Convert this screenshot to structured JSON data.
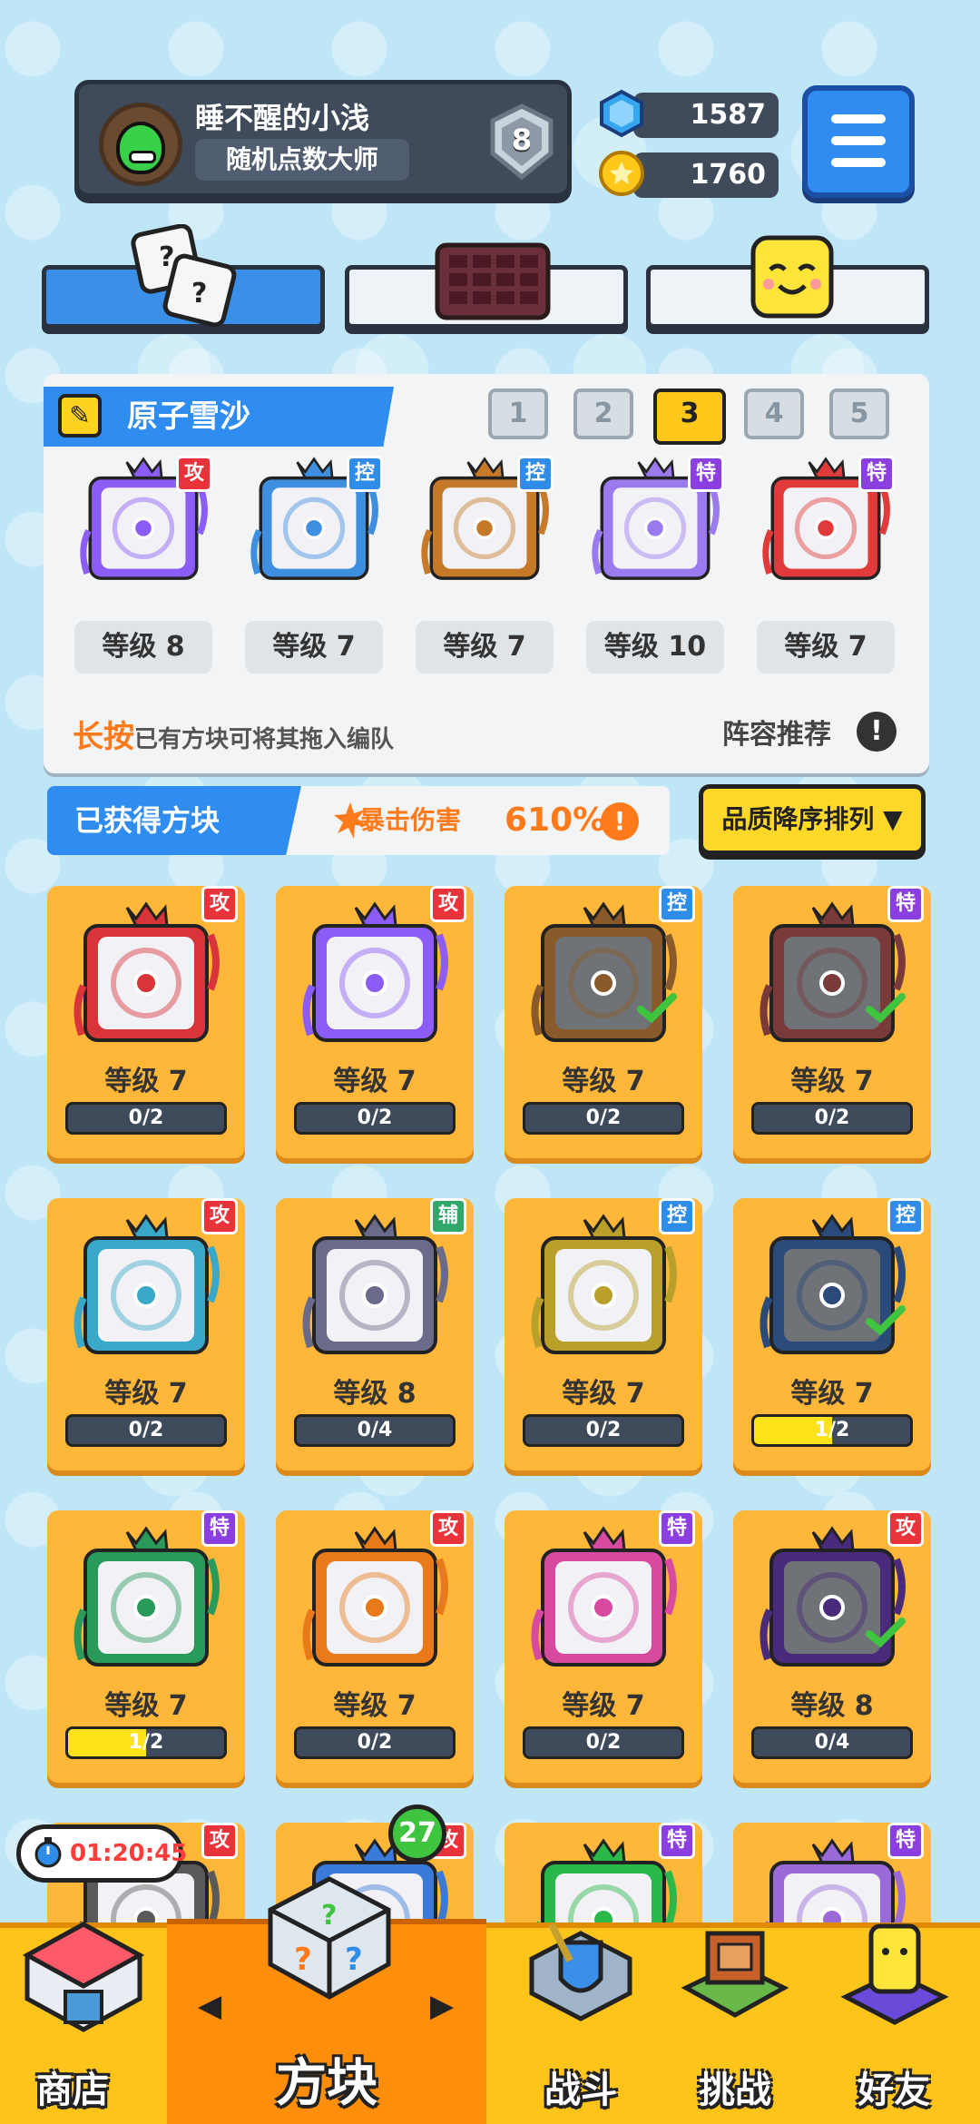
{
  "header": {
    "username": "睡不醒的小浅",
    "title": "随机点数大师",
    "rank": "8",
    "gems": "1587",
    "coins": "1760"
  },
  "tabs": [
    {
      "name": "dice"
    },
    {
      "name": "board"
    },
    {
      "name": "emote"
    }
  ],
  "deck": {
    "name": "原子雪沙",
    "slots": [
      "1",
      "2",
      "3",
      "4",
      "5"
    ],
    "active_slot": "3",
    "cards": [
      {
        "tag": "攻",
        "level": "等级 8",
        "color": "#8b5cf6",
        "tagColor": "#e8333a"
      },
      {
        "tag": "控",
        "level": "等级 7",
        "color": "#3f8fe0",
        "tagColor": "#2f8ce8"
      },
      {
        "tag": "控",
        "level": "等级 7",
        "color": "#c7792a",
        "tagColor": "#2f8ce8"
      },
      {
        "tag": "特",
        "level": "等级 10",
        "color": "#9b7af0",
        "tagColor": "#8b3fe0"
      },
      {
        "tag": "特",
        "level": "等级 7",
        "color": "#e03a3a",
        "tagColor": "#8b3fe0"
      }
    ],
    "hint_highlight": "长按",
    "hint_rest": "已有方块可将其拖入编队",
    "lineup_recommend": "阵容推荐",
    "info_icon": "!"
  },
  "owned": {
    "title": "已获得方块",
    "crit_label": "暴击伤害",
    "crit_value": "610%",
    "info_icon": "!",
    "sort_label": "品质降序排列 ▼"
  },
  "cards": [
    {
      "tag": "攻",
      "level": "等级 7",
      "progress": "0/2",
      "fill": 0,
      "color": "#d8343a",
      "tagColor": "#e8333a",
      "check": false
    },
    {
      "tag": "攻",
      "level": "等级 7",
      "progress": "0/2",
      "fill": 0,
      "color": "#8b5cf6",
      "tagColor": "#e8333a",
      "check": false
    },
    {
      "tag": "控",
      "level": "等级 7",
      "progress": "0/2",
      "fill": 0,
      "color": "#8a5a2a",
      "tagColor": "#2f8ce8",
      "check": true
    },
    {
      "tag": "特",
      "level": "等级 7",
      "progress": "0/2",
      "fill": 0,
      "color": "#7a3a3a",
      "tagColor": "#8b3fe0",
      "check": true
    },
    {
      "tag": "攻",
      "level": "等级 7",
      "progress": "0/2",
      "fill": 0,
      "color": "#3aa8c8",
      "tagColor": "#e8333a",
      "check": false
    },
    {
      "tag": "辅",
      "level": "等级 8",
      "progress": "0/4",
      "fill": 0,
      "color": "#6a6a8a",
      "tagColor": "#2fa86a",
      "check": false
    },
    {
      "tag": "控",
      "level": "等级 7",
      "progress": "0/2",
      "fill": 0,
      "color": "#b8a02a",
      "tagColor": "#2f8ce8",
      "check": false
    },
    {
      "tag": "控",
      "level": "等级 7",
      "progress": "1/2",
      "fill": 0.5,
      "color": "#2a4a7a",
      "tagColor": "#2f8ce8",
      "check": true
    },
    {
      "tag": "特",
      "level": "等级 7",
      "progress": "1/2",
      "fill": 0.5,
      "color": "#2a9a5a",
      "tagColor": "#8b3fe0",
      "check": false
    },
    {
      "tag": "攻",
      "level": "等级 7",
      "progress": "0/2",
      "fill": 0,
      "color": "#e87a1a",
      "tagColor": "#e8333a",
      "check": false
    },
    {
      "tag": "特",
      "level": "等级 7",
      "progress": "0/2",
      "fill": 0,
      "color": "#d84aa0",
      "tagColor": "#8b3fe0",
      "check": false
    },
    {
      "tag": "攻",
      "level": "等级 8",
      "progress": "0/4",
      "fill": 0,
      "color": "#4a2a7a",
      "tagColor": "#e8333a",
      "check": true
    },
    {
      "tag": "攻",
      "level": "",
      "progress": "",
      "fill": 0,
      "color": "#5a5a5a",
      "tagColor": "#e8333a",
      "check": false
    },
    {
      "tag": "攻",
      "level": "",
      "progress": "",
      "fill": 0,
      "color": "#3a7ad8",
      "tagColor": "#e8333a",
      "check": false
    },
    {
      "tag": "特",
      "level": "",
      "progress": "",
      "fill": 0,
      "color": "#2ab84a",
      "tagColor": "#8b3fe0",
      "check": false
    },
    {
      "tag": "特",
      "level": "",
      "progress": "",
      "fill": 0,
      "color": "#9a6ad8",
      "tagColor": "#8b3fe0",
      "check": false
    }
  ],
  "nav": {
    "shop": "商店",
    "blocks": "方块",
    "battle": "战斗",
    "challenge": "挑战",
    "friends": "好友",
    "timer": "01:20:45",
    "badge": "27"
  }
}
